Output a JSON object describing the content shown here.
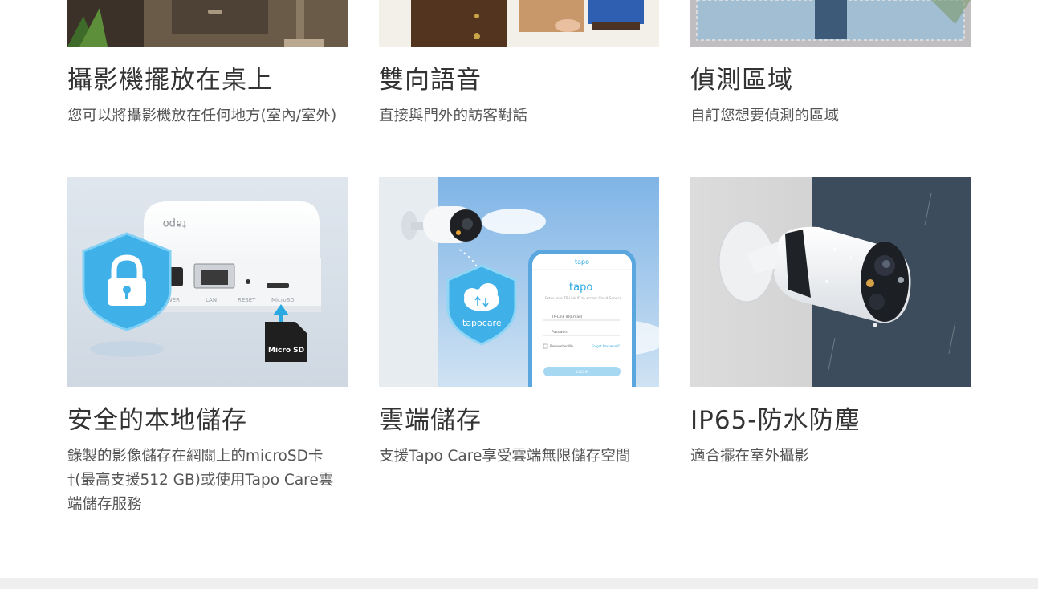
{
  "features": [
    {
      "title": "攝影機擺放在桌上",
      "desc": "您可以將攝影機放在任何地方(室內/室外)"
    },
    {
      "title": "雙向語音",
      "desc": "直接與門外的訪客對話"
    },
    {
      "title": "偵測區域",
      "desc": "自訂您想要偵測的區域"
    },
    {
      "title": "安全的本地儲存",
      "desc": "錄製的影像儲存在網關上的microSD卡†(最高支援512 GB)或使用Tapo Care雲端儲存服務",
      "image": {
        "brand": "tapo",
        "ports": [
          "POWER",
          "LAN",
          "RESET",
          "MicroSD"
        ],
        "card_label": "Micro SD"
      }
    },
    {
      "title": "雲端儲存",
      "desc": "支援Tapo Care享受雲端無限儲存空間",
      "image": {
        "shield_label": "tapocare",
        "app_header": "tapo",
        "app_logo": "tapo",
        "app_intro": "Enter your TP-Link ID to access Cloud Service",
        "email_placeholder": "TP-Link ID(Email)",
        "password_placeholder": "Password",
        "remember_label": "Remember Me",
        "forgot_label": "Forgot Password?",
        "login_label": "LOG IN"
      }
    },
    {
      "title": "IP65-防水防塵",
      "desc": "適合擺在室外攝影"
    }
  ],
  "colors": {
    "shield_blue": "#3fb0e8",
    "accent_blue": "#2aa8e0",
    "sky": "#9cc6ea"
  }
}
